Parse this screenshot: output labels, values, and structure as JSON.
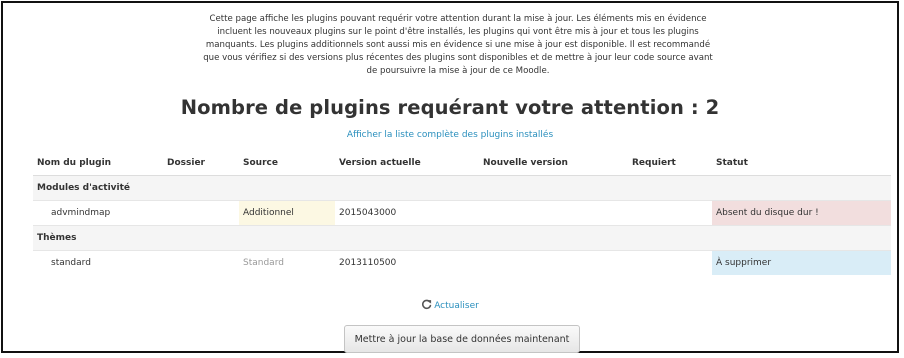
{
  "intro_text": "Cette page affiche les plugins pouvant requérir votre attention durant la mise à jour. Les éléments mis en évidence incluent les nouveaux plugins sur le point d'être installés, les plugins qui vont être mis à jour et tous les plugins manquants. Les plugins additionnels sont aussi mis en évidence si une mise à jour est disponible. Il est recommandé que vous vérifiez si des versions plus récentes des plugins sont disponibles et de mettre à jour leur code source avant de poursuivre la mise à jour de ce Moodle.",
  "heading": "Nombre de plugins requérant votre attention : 2",
  "show_all_link": "Afficher la liste complète des plugins installés",
  "table": {
    "columns": [
      "Nom du plugin",
      "Dossier",
      "Source",
      "Version actuelle",
      "Nouvelle version",
      "Requiert",
      "Statut"
    ],
    "groups": [
      {
        "name": "Modules d'activité",
        "plugins": [
          {
            "name": "advmindmap",
            "directory": "",
            "source": "Additionnel",
            "current_version": "2015043000",
            "new_version": "",
            "requires": "",
            "status": "Absent du disque dur !"
          }
        ]
      },
      {
        "name": "Thèmes",
        "plugins": [
          {
            "name": "standard",
            "directory": "",
            "source": "Standard",
            "current_version": "2013110500",
            "new_version": "",
            "requires": "",
            "status": "À supprimer"
          }
        ]
      }
    ]
  },
  "refresh_link": "Actualiser",
  "upgrade_button": "Mettre à jour la base de données maintenant",
  "colors": {
    "link": "#2a8fbd",
    "additional_bg": "#fcf8e3",
    "missing_bg": "#f2dede",
    "delete_bg": "#d9edf7",
    "group_bg": "#f5f5f5"
  }
}
